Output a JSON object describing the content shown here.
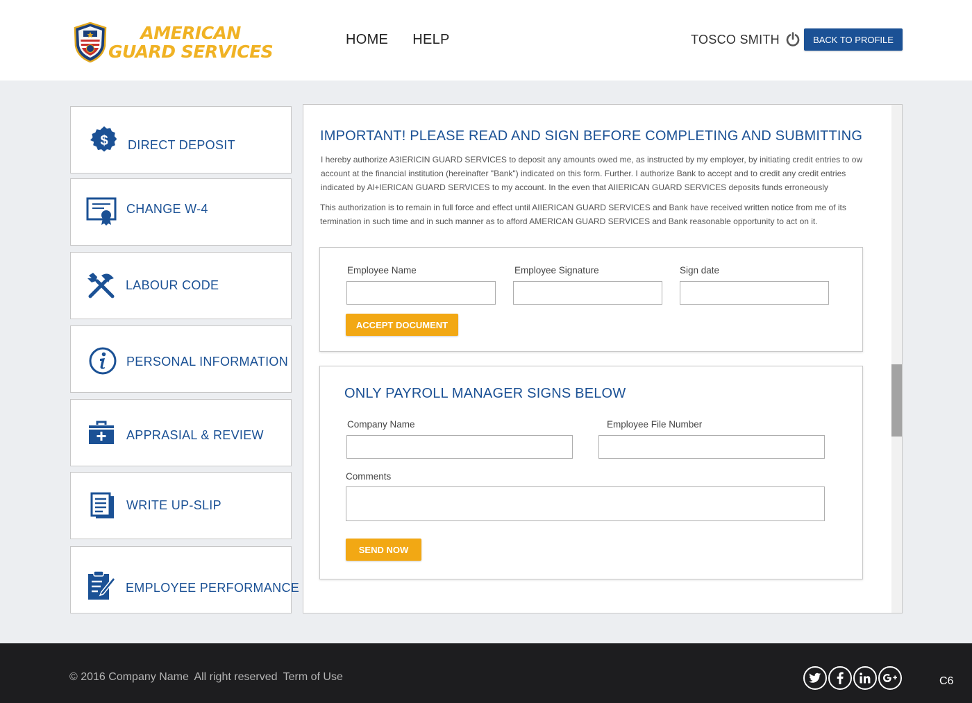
{
  "brand": {
    "line1": "AMERICAN",
    "line2": "GUARD SERVICES"
  },
  "nav": {
    "home": "HOME",
    "help": "HELP"
  },
  "user": {
    "name": "TOSCO SMITH",
    "back_label": "BACK TO PROFILE"
  },
  "sidebar": {
    "items": [
      {
        "label": "DIRECT DEPOSIT",
        "icon": "dollar-badge-icon"
      },
      {
        "label": "CHANGE W-4",
        "icon": "certificate-icon"
      },
      {
        "label": "LABOUR CODE",
        "icon": "tools-icon"
      },
      {
        "label": "PERSONAL INFORMATION",
        "icon": "info-icon"
      },
      {
        "label": "APPRASIAL & REVIEW",
        "icon": "medical-briefcase-icon"
      },
      {
        "label": "WRITE UP-SLIP",
        "icon": "document-icon"
      },
      {
        "label": "EMPLOYEE PERFORMANCE",
        "icon": "clipboard-edit-icon"
      }
    ]
  },
  "main": {
    "title": "IMPORTANT! PLEASE READ AND SIGN BEFORE COMPLETING AND SUBMITTING",
    "paragraph1": "I hereby authorize A3IERICIN GUARD SERVICES to deposit any amounts owed me, as instructed by my employer, by initiating credit entries to ow account at the financial institution (hereinafter \"Bank\") indicated on this form. Further. I authorize Bank to accept and to credit any credit entries indicated by Al+IERICAN GUARD SERVICES to my account. In the even that AIIERICAN GUARD SERVICES deposits funds erroneously",
    "paragraph2": "This authorization is to remain in full force and effect until AIIERICAN GUARD SERVICES and Bank have received written notice from me of its termination in such time and in such manner as to afford AMERICAN GUARD SERVICES and Bank reasonable opportunity to act on it.",
    "employee_form": {
      "name_label": "Employee Name",
      "name_value": "",
      "signature_label": "Employee Signature",
      "signature_value": "",
      "date_label": "Sign date",
      "date_value": "",
      "accept_label": "ACCEPT DOCUMENT"
    },
    "payroll_form": {
      "title": "ONLY PAYROLL MANAGER SIGNS BELOW",
      "company_label": "Company Name",
      "company_value": "",
      "file_number_label": "Employee File Number",
      "file_number_value": "",
      "comments_label": "Comments",
      "comments_value": "",
      "send_label": "SEND NOW"
    }
  },
  "footer": {
    "copyright": "© 2016 Company Name",
    "rights": "All right reserved",
    "terms": "Term of Use",
    "social": [
      {
        "name": "twitter-icon"
      },
      {
        "name": "facebook-icon"
      },
      {
        "name": "linkedin-icon"
      },
      {
        "name": "googleplus-icon"
      }
    ],
    "code": "C6"
  },
  "colors": {
    "brand_blue": "#1b5195",
    "accent_orange": "#f2a814",
    "logo_gold": "#f0b224",
    "footer_bg": "#1d1d1f"
  }
}
